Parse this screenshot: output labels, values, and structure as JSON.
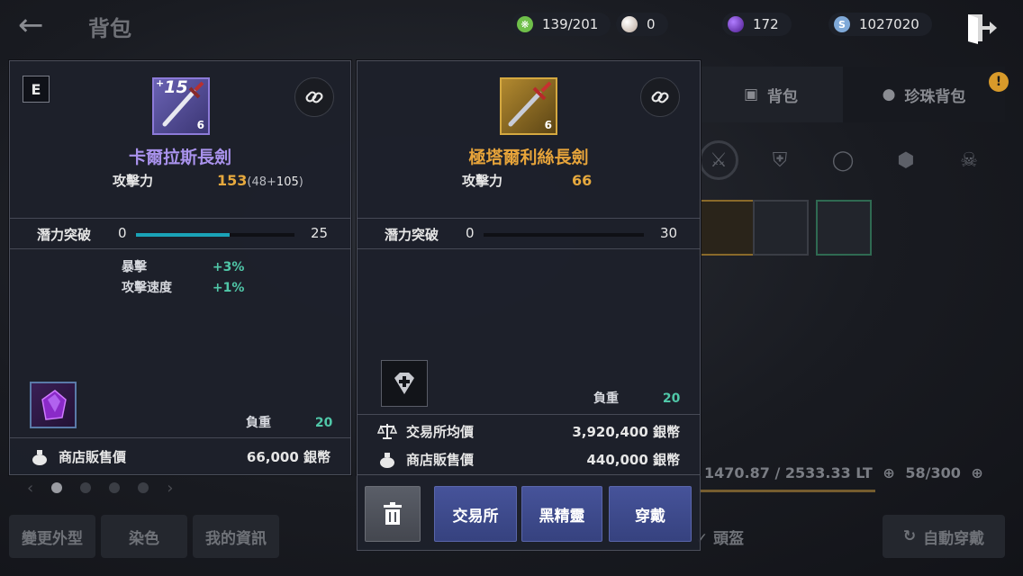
{
  "header": {
    "title": "背包",
    "currencies": [
      {
        "icon": "energy-icon",
        "value": "139/201",
        "color": "#6fbf4a"
      },
      {
        "icon": "pearl-icon",
        "value": "0",
        "color": "#d9c7b8"
      },
      {
        "icon": "dark-orb-icon",
        "value": "172",
        "color": "#7a3fc8"
      },
      {
        "icon": "silver-coin-icon",
        "value": "1027020",
        "color": "#7fa9d8"
      }
    ]
  },
  "bag": {
    "tabs": [
      "背包",
      "珍珠背包"
    ],
    "notice": "!",
    "weight_info": "1470.87 / 2533.33 LT",
    "slots_info": "58/300",
    "helmet_label": "頭盔",
    "auto_equip_label": "自動穿戴"
  },
  "left_bottom": {
    "buttons": [
      "變更外型",
      "染色",
      "我的資訊"
    ]
  },
  "equipped_card": {
    "badge": "E",
    "enhance_prefix": "+",
    "enhance": "15",
    "grade": "6",
    "name": "卡爾拉斯長劍",
    "attack_label": "攻擊力",
    "attack_value": "153",
    "attack_detail_open": "(48+",
    "attack_detail_bonus": "105",
    "attack_detail_close": ")",
    "potential_label": "潛力突破",
    "potential_min": "0",
    "potential_max": "25",
    "potential_progress": 0.59,
    "stats": [
      {
        "name": "暴擊",
        "value": "+3%"
      },
      {
        "name": "攻擊速度",
        "value": "+1%"
      }
    ],
    "weight_label": "負重",
    "weight_value": "20",
    "shop_price_label": "商店販售價",
    "shop_price_value": "66,000 銀幣"
  },
  "compare_card": {
    "grade": "6",
    "name": "極塔爾利絲長劍",
    "attack_label": "攻擊力",
    "attack_value": "66",
    "potential_label": "潛力突破",
    "potential_min": "0",
    "potential_max": "30",
    "potential_progress": 0,
    "weight_label": "負重",
    "weight_value": "20",
    "market_price_label": "交易所均價",
    "market_price_value": "3,920,400 銀幣",
    "shop_price_label": "商店販售價",
    "shop_price_value": "440,000 銀幣"
  },
  "actions": {
    "market": "交易所",
    "black_spirit": "黑精靈",
    "equip": "穿戴"
  }
}
